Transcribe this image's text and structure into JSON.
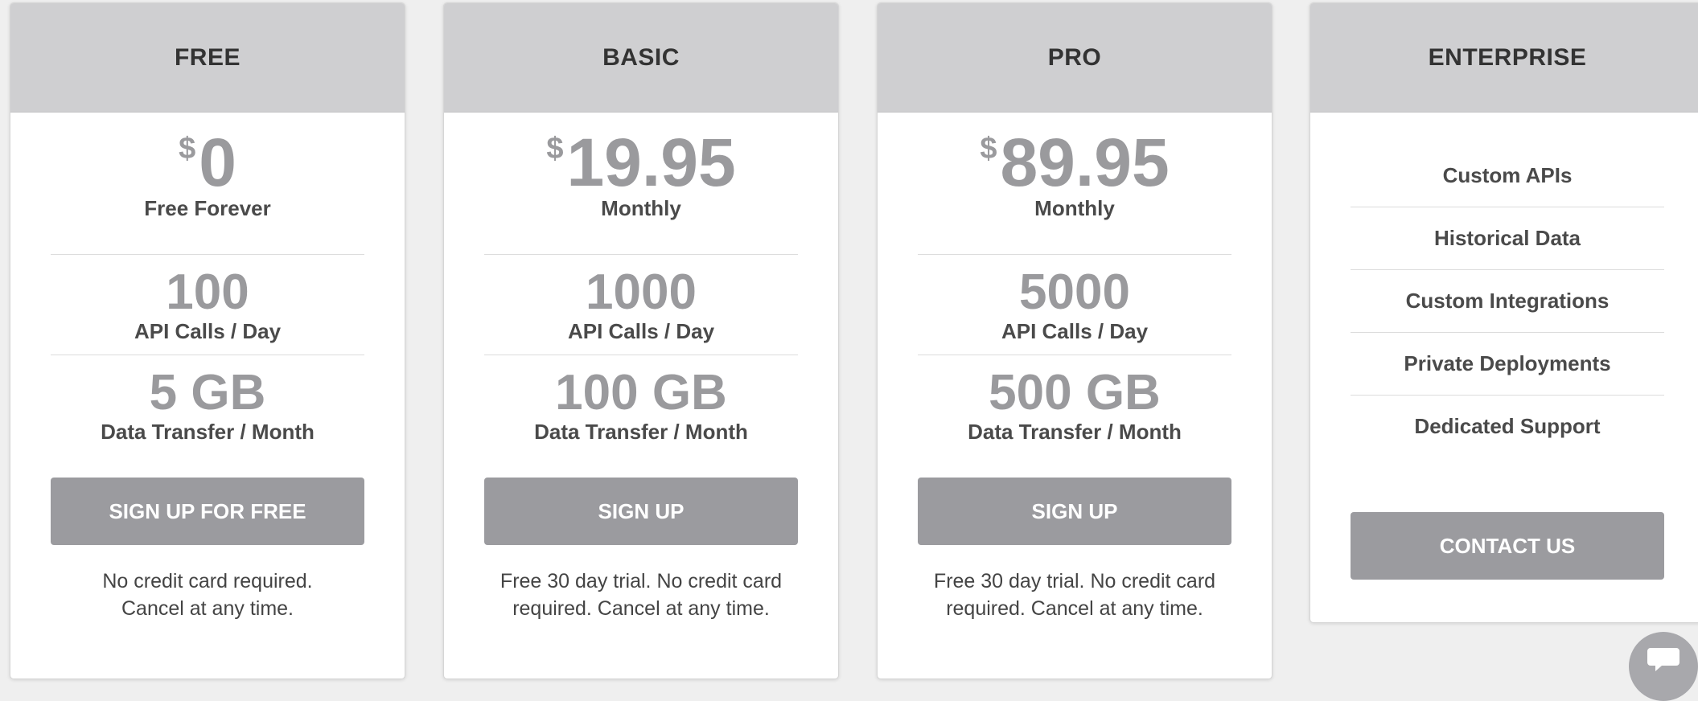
{
  "plans": [
    {
      "title": "FREE",
      "currency": "$",
      "price": "0",
      "price_sub": "Free Forever",
      "api_calls": "100",
      "api_calls_label": "API Calls / Day",
      "data_transfer": "5 GB",
      "data_transfer_label": "Data Transfer / Month",
      "button": "SIGN UP FOR FREE",
      "note_line1": "No credit card required.",
      "note_line2": "Cancel at any time."
    },
    {
      "title": "BASIC",
      "currency": "$",
      "price": "19.95",
      "price_sub": "Monthly",
      "api_calls": "1000",
      "api_calls_label": "API Calls / Day",
      "data_transfer": "100 GB",
      "data_transfer_label": "Data Transfer / Month",
      "button": "SIGN UP",
      "note_line1": "Free 30 day trial. No credit card",
      "note_line2": "required. Cancel at any time."
    },
    {
      "title": "PRO",
      "currency": "$",
      "price": "89.95",
      "price_sub": "Monthly",
      "api_calls": "5000",
      "api_calls_label": "API Calls / Day",
      "data_transfer": "500 GB",
      "data_transfer_label": "Data Transfer / Month",
      "button": "SIGN UP",
      "note_line1": "Free 30 day trial. No credit card",
      "note_line2": "required. Cancel at any time."
    }
  ],
  "enterprise": {
    "title": "ENTERPRISE",
    "features": [
      "Custom APIs",
      "Historical Data",
      "Custom Integrations",
      "Private Deployments",
      "Dedicated Support"
    ],
    "button": "CONTACT US"
  },
  "chat_widget": {
    "icon": "chat-icon"
  },
  "colors": {
    "header_bg": "#cfcfd1",
    "button_bg": "#9b9b9f",
    "price_text": "#9a9a9d"
  }
}
